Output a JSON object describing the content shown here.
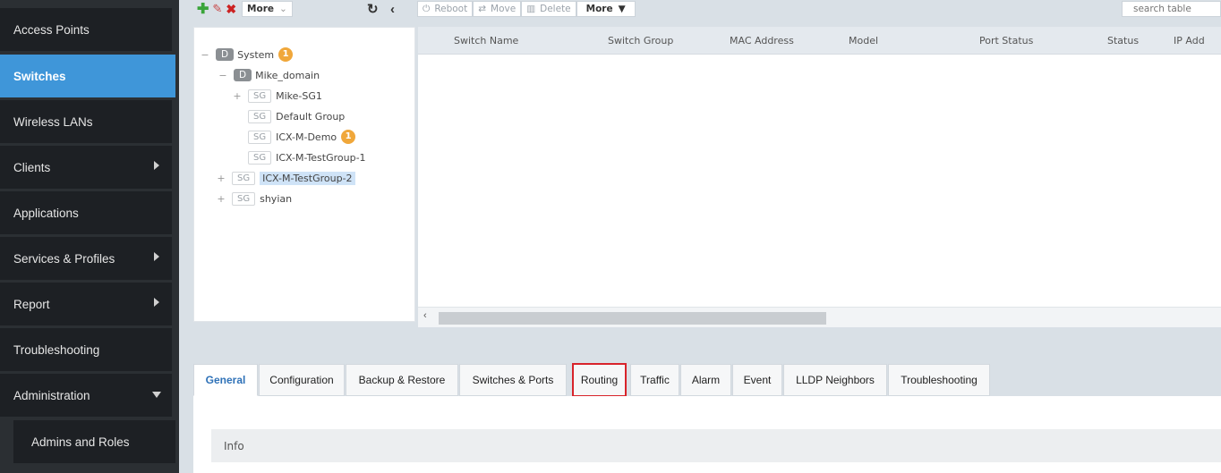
{
  "sidebar": {
    "items": [
      {
        "label": "Access Points"
      },
      {
        "label": "Switches"
      },
      {
        "label": "Wireless LANs"
      },
      {
        "label": "Clients"
      },
      {
        "label": "Applications"
      },
      {
        "label": "Services & Profiles"
      },
      {
        "label": "Report"
      },
      {
        "label": "Troubleshooting"
      },
      {
        "label": "Administration"
      }
    ],
    "sub_items": [
      {
        "label": "Admins and Roles"
      }
    ]
  },
  "toolbar": {
    "more_label": "More",
    "reboot_label": "Reboot",
    "move_label": "Move",
    "delete_label": "Delete",
    "more2_label": "More",
    "search_placeholder": "search table"
  },
  "tree": {
    "root": {
      "badge": "D",
      "label": "System",
      "count": "1"
    },
    "domain": {
      "badge": "D",
      "label": "Mike_domain"
    },
    "groups": [
      {
        "badge": "SG",
        "label": "Mike-SG1"
      },
      {
        "badge": "SG",
        "label": "Default Group"
      },
      {
        "badge": "SG",
        "label": "ICX-M-Demo",
        "count": "1"
      },
      {
        "badge": "SG",
        "label": "ICX-M-TestGroup-1"
      },
      {
        "badge": "SG",
        "label": "ICX-M-TestGroup-2"
      },
      {
        "badge": "SG",
        "label": "shyian"
      }
    ]
  },
  "grid": {
    "columns": [
      "Switch Name",
      "Switch Group",
      "MAC Address",
      "Model",
      "Port Status",
      "Status",
      "IP Add"
    ]
  },
  "tabs": [
    "General",
    "Configuration",
    "Backup & Restore",
    "Switches & Ports",
    "Routing",
    "Traffic",
    "Alarm",
    "Event",
    "LLDP Neighbors",
    "Troubleshooting"
  ],
  "content": {
    "info_label": "Info"
  },
  "colors": {
    "accent": "#3f96d9",
    "badge_orange": "#f0a73a",
    "highlight_red": "#d8232a"
  }
}
